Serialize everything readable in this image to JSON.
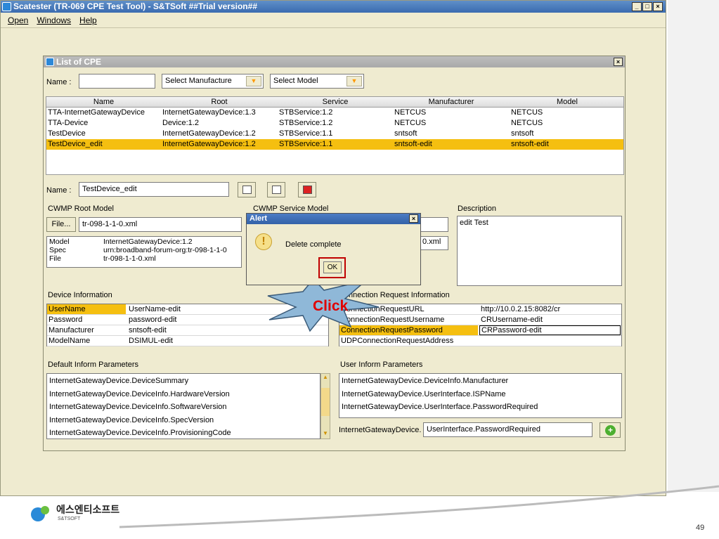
{
  "window": {
    "title": "Scatester (TR-069 CPE Test Tool) - S&TSoft ##Trial version##",
    "min": "_",
    "max": "□",
    "close": "×"
  },
  "menu": [
    "Open",
    "Windows",
    "Help"
  ],
  "cpe": {
    "title": "List of CPE",
    "close": "×",
    "filter": {
      "name_label": "Name :",
      "name_value": "",
      "manufacture": "Select Manufacture",
      "model": "Select Model"
    },
    "columns": [
      "Name",
      "Root",
      "Service",
      "Manufacturer",
      "Model"
    ],
    "rows": [
      [
        "TTA-InternetGatewayDevice",
        "InternetGatewayDevice:1.3",
        "STBService:1.2",
        "NETCUS",
        "NETCUS"
      ],
      [
        "TTA-Device",
        "Device:1.2",
        "STBService:1.2",
        "NETCUS",
        "NETCUS"
      ],
      [
        "TestDevice",
        "InternetGatewayDevice:1.2",
        "STBService:1.1",
        "sntsoft",
        "sntsoft"
      ],
      [
        "TestDevice_edit",
        "InternetGatewayDevice:1.2",
        "STBService:1.1",
        "sntsoft-edit",
        "sntsoft-edit"
      ]
    ],
    "selected_row": 3,
    "name_label": "Name :",
    "name_value": "TestDevice_edit",
    "root_model": {
      "label": "CWMP Root Model",
      "file_btn": "File...",
      "file": "tr-098-1-1-0.xml",
      "props": [
        [
          "Model",
          "InternetGatewayDevice:1.2"
        ],
        [
          "Spec",
          "urn:broadband-forum-org:tr-098-1-1-0"
        ],
        [
          "File",
          "tr-098-1-1-0.xml"
        ]
      ]
    },
    "service_model": {
      "label": "CWMP Service Model",
      "file_partial": "0.xml"
    },
    "description": {
      "label": "Description",
      "value": "edit Test"
    },
    "device_info": {
      "label": "Device Information",
      "fields": [
        [
          "UserName",
          "UserName-edit"
        ],
        [
          "Password",
          "password-edit"
        ],
        [
          "Manufacturer",
          "sntsoft-edit"
        ],
        [
          "ModelName",
          "DSIMUL-edit"
        ]
      ]
    },
    "conn_req": {
      "label": "Connection Request Information",
      "fields": [
        [
          "ConnectionRequestURL",
          "http://10.0.2.15:8082/cr"
        ],
        [
          "ConnectionRequestUsername",
          "CRUsername-edit"
        ],
        [
          "ConnectionRequestPassword",
          "CRPassword-edit"
        ],
        [
          "UDPConnectionRequestAddress",
          ""
        ]
      ]
    },
    "default_inform": {
      "label": "Default Inform Parameters",
      "items": [
        "InternetGatewayDevice.DeviceSummary",
        "InternetGatewayDevice.DeviceInfo.HardwareVersion",
        "InternetGatewayDevice.DeviceInfo.SoftwareVersion",
        "InternetGatewayDevice.DeviceInfo.SpecVersion",
        "InternetGatewayDevice.DeviceInfo.ProvisioningCode"
      ]
    },
    "user_inform": {
      "label": "User Inform Parameters",
      "items": [
        "InternetGatewayDevice.DeviceInfo.Manufacturer",
        "InternetGatewayDevice.UserInterface.ISPName",
        "InternetGatewayDevice.UserInterface.PasswordRequired"
      ],
      "prefix": "InternetGatewayDevice.",
      "input": "UserInterface.PasswordRequired"
    }
  },
  "alert": {
    "title": "Alert",
    "close": "×",
    "message": "Delete complete",
    "ok": "OK",
    "callout": "Click"
  },
  "slide": {
    "company": "에스엔티소프트",
    "company_sub": "S&TSOFT",
    "page": "49"
  },
  "colors": {
    "selection": "#f5bf10",
    "window_bg": "#efebd0",
    "title": "#3a6bb0",
    "callout": "#8fb8d8",
    "callout_text": "#e00000"
  }
}
